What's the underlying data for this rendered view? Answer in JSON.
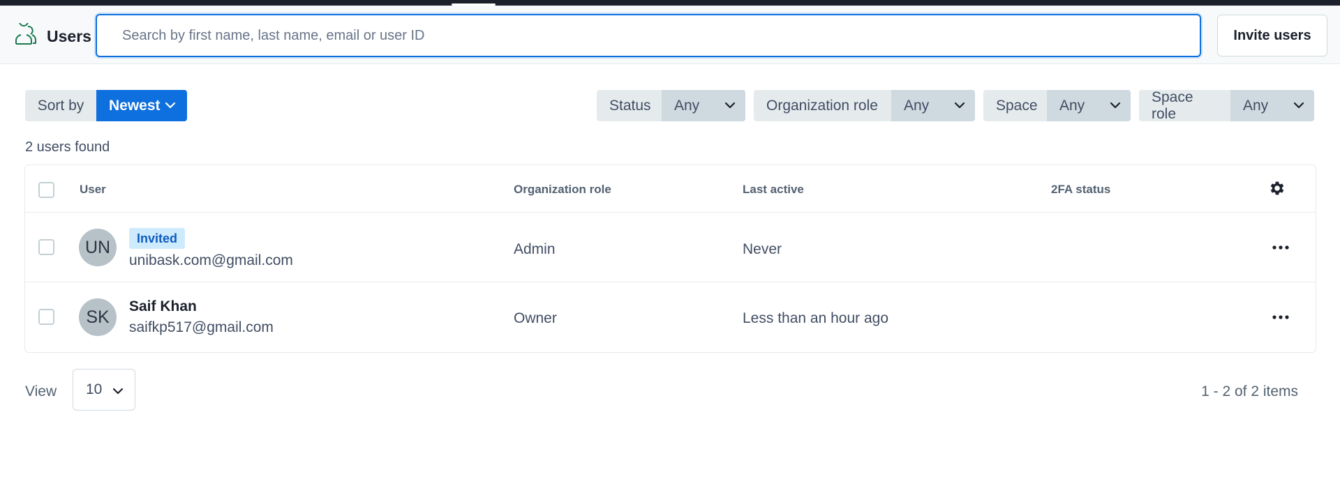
{
  "header": {
    "title": "Users",
    "icon": "users-icon",
    "search_placeholder": "Search by first name, last name, email or user ID",
    "search_value": "",
    "invite_label": "Invite users"
  },
  "toolbar": {
    "sort_label": "Sort by",
    "sort_value": "Newest",
    "filters": [
      {
        "label": "Status",
        "value": "Any"
      },
      {
        "label": "Organization role",
        "value": "Any"
      },
      {
        "label": "Space",
        "value": "Any"
      },
      {
        "label": "Space role",
        "value": "Any"
      }
    ]
  },
  "results": {
    "count_text": "2 users found"
  },
  "table": {
    "columns": [
      "User",
      "Organization role",
      "Last active",
      "2FA status"
    ],
    "rows": [
      {
        "initials": "UN",
        "badge": "Invited",
        "name": "",
        "email": "unibask.com@gmail.com",
        "role": "Admin",
        "last_active": "Never",
        "twofa": ""
      },
      {
        "initials": "SK",
        "badge": "",
        "name": "Saif Khan",
        "email": "saifkp517@gmail.com",
        "role": "Owner",
        "last_active": "Less than an hour ago",
        "twofa": ""
      }
    ]
  },
  "pagination": {
    "view_label": "View",
    "page_size": "10",
    "info": "1 - 2 of 2 items"
  },
  "colors": {
    "accent": "#0e6fde",
    "badge_bg": "#ceebfd",
    "topbar": "#1b202b",
    "icon_green": "#1a7a4f"
  }
}
